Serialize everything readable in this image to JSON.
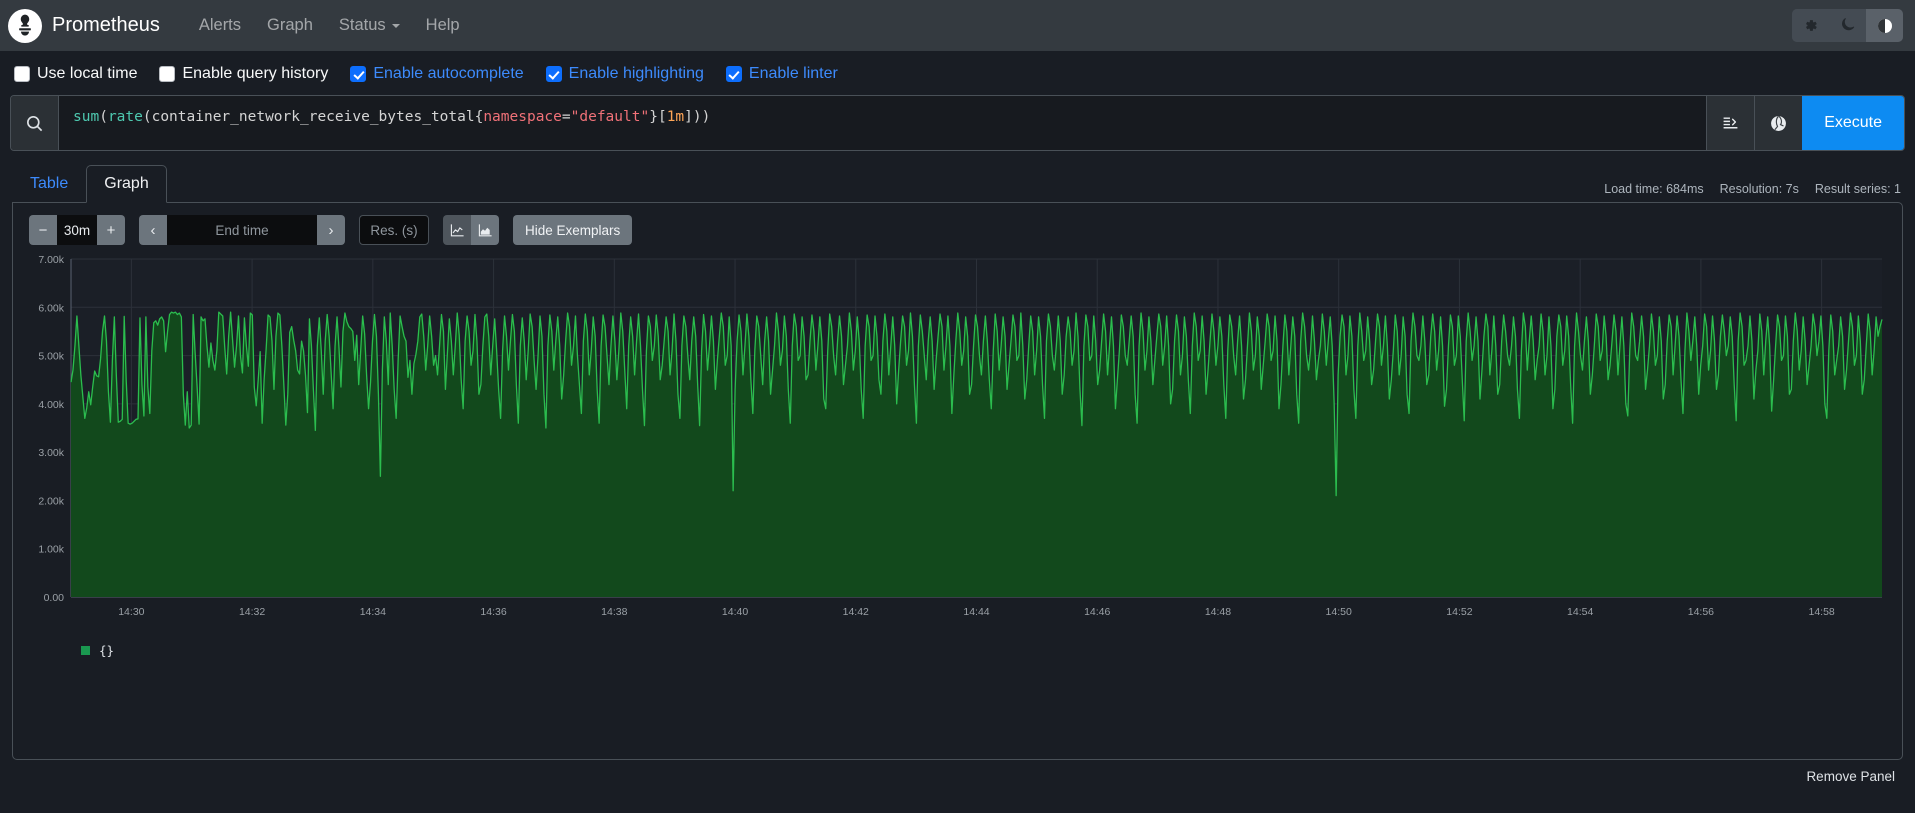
{
  "navbar": {
    "brand": "Prometheus",
    "logo_icon": "prometheus-torch-icon",
    "links": [
      {
        "label": "Alerts",
        "name": "nav-link-alerts",
        "caret": false
      },
      {
        "label": "Graph",
        "name": "nav-link-graph",
        "caret": false
      },
      {
        "label": "Status",
        "name": "nav-link-status",
        "caret": true
      },
      {
        "label": "Help",
        "name": "nav-link-help",
        "caret": false
      }
    ],
    "theme_buttons": [
      {
        "icon": "gear-icon",
        "name": "theme-settings-button",
        "active": false
      },
      {
        "icon": "moon-icon",
        "name": "theme-dark-button",
        "active": false
      },
      {
        "icon": "half-circle-icon",
        "name": "theme-auto-button",
        "active": true
      }
    ]
  },
  "options": [
    {
      "label": "Use local time",
      "checked": false,
      "name": "checkbox-use-local-time"
    },
    {
      "label": "Enable query history",
      "checked": false,
      "name": "checkbox-enable-query-history"
    },
    {
      "label": "Enable autocomplete",
      "checked": true,
      "name": "checkbox-enable-autocomplete"
    },
    {
      "label": "Enable highlighting",
      "checked": true,
      "name": "checkbox-enable-highlighting"
    },
    {
      "label": "Enable linter",
      "checked": true,
      "name": "checkbox-enable-linter"
    }
  ],
  "query": {
    "expression": "sum (rate(container_network_receive_bytes_total{namespace=\"default\"}[1m]))",
    "tokens": [
      {
        "t": "sum ",
        "k": "fn"
      },
      {
        "t": "(",
        "k": "plain"
      },
      {
        "t": "rate",
        "k": "fn"
      },
      {
        "t": "(container_network_receive_bytes_total{",
        "k": "plain"
      },
      {
        "t": "namespace",
        "k": "lbl"
      },
      {
        "t": "=",
        "k": "plain"
      },
      {
        "t": "\"default\"",
        "k": "str"
      },
      {
        "t": "}[",
        "k": "plain"
      },
      {
        "t": "1m",
        "k": "dur"
      },
      {
        "t": "]))",
        "k": "plain"
      }
    ],
    "search_icon": "search-icon",
    "format_icon": "format-expression-icon",
    "history_icon": "metrics-explorer-icon",
    "execute_label": "Execute"
  },
  "tabs": [
    {
      "label": "Table",
      "active": false,
      "name": "tab-table"
    },
    {
      "label": "Graph",
      "active": true,
      "name": "tab-graph"
    }
  ],
  "stats": {
    "load_time": "Load time: 684ms",
    "resolution": "Resolution: 7s",
    "result_series": "Result series: 1"
  },
  "controls": {
    "decrease_label": "−",
    "range_value": "30m",
    "increase_label": "+",
    "prev_label": "‹",
    "end_time_placeholder": "End time",
    "end_time_value": "",
    "next_label": "›",
    "resolution_placeholder": "Res. (s)",
    "resolution_value": "",
    "chart_types": [
      {
        "icon": "line-chart-icon",
        "name": "chart-type-line-button",
        "selected": true
      },
      {
        "icon": "stacked-area-chart-icon",
        "name": "chart-type-stacked-button",
        "selected": false
      }
    ],
    "exemplars_label": "Hide Exemplars"
  },
  "legend": [
    {
      "label": "{}",
      "color": "#1a9850"
    }
  ],
  "footer": {
    "remove_panel_label": "Remove Panel"
  },
  "colors": {
    "accent": "#0d8bf2",
    "series_stroke": "#2bbd4e",
    "series_fill": "#12491c",
    "plot_bg": "#1b1f27",
    "grid": "#2c313a",
    "navbar_bg": "#343a40",
    "page_bg": "#191d24"
  },
  "chart_data": {
    "type": "area",
    "title": "",
    "xlabel": "",
    "ylabel": "",
    "grid": true,
    "legend_position": "bottom-left",
    "series_name": "{}",
    "stroke": "#2bbd4e",
    "fill": "#12491c",
    "xtick_labels": [
      "14:30",
      "14:32",
      "14:34",
      "14:36",
      "14:38",
      "14:40",
      "14:42",
      "14:44",
      "14:46",
      "14:48",
      "14:50",
      "14:52",
      "14:54",
      "14:56",
      "14:58"
    ],
    "ytick_labels": [
      "0.00",
      "1.00k",
      "2.00k",
      "3.00k",
      "4.00k",
      "5.00k",
      "6.00k",
      "7.00k"
    ],
    "ylim": [
      0,
      7000
    ],
    "ytick_values": [
      0,
      1000,
      2000,
      3000,
      4000,
      5000,
      6000,
      7000
    ],
    "x_start_minutes": 869.2,
    "x_end_minutes": 898.5,
    "xlim_minutes": [
      869.2,
      898.5
    ],
    "values": [
      4450,
      4700,
      5200,
      5820,
      5200,
      4600,
      4150,
      3700,
      3920,
      4250,
      3980,
      4350,
      4680,
      4580,
      4560,
      4930,
      5500,
      5820,
      5300,
      4250,
      3620,
      4900,
      5800,
      4600,
      3620,
      3640,
      3680,
      5810,
      4500,
      3600,
      3580,
      3600,
      3640,
      3680,
      3690,
      5780,
      4400,
      3750,
      5800,
      4350,
      3800,
      5100,
      5680,
      5720,
      5630,
      5760,
      5800,
      5720,
      5080,
      5500,
      5850,
      5900,
      5880,
      5900,
      5850,
      5880,
      5800,
      4200,
      3560,
      4250,
      3500,
      3560,
      5850,
      5050,
      4350,
      3580,
      5800,
      5720,
      5760,
      5200,
      4760,
      5260,
      4900,
      4700,
      5100,
      5900,
      5860,
      5820,
      5180,
      4620,
      5400,
      5900,
      5320,
      4760,
      5200,
      5820,
      5000,
      4640,
      5780,
      5200,
      4780,
      5880,
      5840,
      4350,
      3960,
      4500,
      5080,
      3600,
      4500,
      5120,
      5840,
      5800,
      5300,
      4300,
      5400,
      5880,
      5840,
      5200,
      4400,
      3560,
      4200,
      5480,
      5600,
      5320,
      5100,
      4700,
      4620,
      5300,
      5100,
      4600,
      3820,
      5760,
      5200,
      4300,
      3450,
      5200,
      5780,
      5100,
      4200,
      5300,
      5850,
      5400,
      4650,
      3900,
      5200,
      5800,
      5150,
      4350,
      5500,
      5880,
      5700,
      5600,
      5560,
      5500,
      4900,
      5420,
      4400,
      5100,
      5820,
      5450,
      4600,
      3900,
      4450,
      5300,
      5850,
      5400,
      4200,
      2500,
      4700,
      5800,
      5300,
      4400,
      5880,
      5200,
      4300,
      3700,
      4900,
      5820,
      5600,
      5400,
      5300,
      4550,
      4900,
      4200,
      4830,
      5020,
      5300,
      5800,
      5860,
      5400,
      4700,
      5200,
      5820,
      5400,
      4800,
      5000,
      4600,
      5200,
      5850,
      5500,
      4300,
      5050,
      5760,
      5300,
      4600,
      5200,
      5880,
      5420,
      4500,
      3900,
      5300,
      5820,
      5500,
      4800,
      5100,
      5850,
      5300,
      4200,
      4400,
      5200,
      5800,
      5860,
      5400,
      4600,
      5200,
      5760,
      5100,
      4300,
      3700,
      5100,
      5820,
      5400,
      4700,
      5300,
      5850,
      5500,
      4400,
      3600,
      5200,
      5780,
      5300,
      4500,
      5100,
      5860,
      5600,
      4900,
      4300,
      5000,
      5820,
      5400,
      4200,
      3500,
      5200,
      5840,
      5500,
      4700,
      5300,
      5800,
      5200,
      4100,
      4600,
      5300,
      5880,
      5600,
      4800,
      5200,
      5820,
      5000,
      4400,
      3800,
      5300,
      5860,
      5500,
      4600,
      5100,
      5800,
      5400,
      4300,
      3600,
      5200,
      5840,
      5600,
      5000,
      4400,
      5200,
      5820,
      5300,
      4500,
      5100,
      5880,
      5500,
      4700,
      3900,
      5200,
      5800,
      5400,
      4600,
      5300,
      5860,
      5200,
      4300,
      3550,
      5100,
      5820,
      5600,
      4900,
      5200,
      5840,
      5400,
      4500,
      4800,
      5300,
      5800,
      5500,
      4600,
      5100,
      5860,
      5300,
      4200,
      3700,
      5200,
      5820,
      5600,
      5000,
      4500,
      5300,
      5800,
      5400,
      4400,
      3550,
      5100,
      5850,
      5500,
      4700,
      5200,
      5820,
      5300,
      4300,
      4900,
      5400,
      5880,
      5600,
      4800,
      5000,
      5800,
      5200,
      2200,
      4300,
      5300,
      5840,
      5500,
      4600,
      5200,
      5860,
      5400,
      4500,
      3800,
      5100,
      5820,
      5600,
      5000,
      4400,
      5300,
      5800,
      5300,
      4200,
      4700,
      5200,
      5880,
      5500,
      4800,
      5100,
      5820,
      5400,
      4300,
      3600,
      5200,
      5860,
      5600,
      4900,
      5000,
      5800,
      5400,
      4500,
      4600,
      5300,
      5840,
      5500,
      4700,
      5200,
      5800,
      5300,
      4100,
      3900,
      5100,
      5860,
      5600,
      5000,
      4600,
      5300,
      5820,
      5400,
      4400,
      4800,
      5200,
      5880,
      5500,
      4700,
      5100,
      5800,
      5300,
      4300,
      3700,
      5200,
      5840,
      5600,
      4900,
      5000,
      5820,
      5400,
      4500,
      4200,
      5300,
      5860,
      5500,
      4600,
      5200,
      5800,
      5200,
      4000,
      4700,
      5300,
      5820,
      5600,
      4800,
      5100,
      5880,
      5400,
      4400,
      3600,
      5200,
      5840,
      5500,
      5000,
      4500,
      5300,
      5800,
      5300,
      4300,
      4900,
      5400,
      5860,
      5600,
      4700,
      5200,
      5820,
      5200,
      3800,
      4600,
      5300,
      5880,
      5500,
      4800,
      5100,
      5800,
      5400,
      4200,
      4400,
      5200,
      5840,
      5600,
      5000,
      4600,
      5300,
      5820,
      5300,
      4500,
      3900,
      5100,
      5860,
      5500,
      4700,
      5200,
      5800,
      5400,
      4300,
      4800,
      5300,
      5840,
      5600,
      4900,
      5000,
      5880,
      5200,
      4100,
      4500,
      5200,
      5820,
      5500,
      4600,
      5100,
      5800,
      5400,
      4400,
      3700,
      5300,
      5860,
      5600,
      5000,
      4700,
      5200,
      5820,
      5300,
      4200,
      4600,
      5400,
      5800,
      5500,
      4800,
      5100,
      5880,
      5400,
      4300,
      3550,
      5200,
      5840,
      5600,
      4900,
      5000,
      5820,
      5300,
      4400,
      4700,
      5300,
      5860,
      5500,
      4600,
      5200,
      5800,
      5200,
      3900,
      4500,
      5100,
      5840,
      5600,
      5000,
      4800,
      5300,
      5820,
      5400,
      4200,
      3600,
      5200,
      5880,
      5500,
      4700,
      5100,
      5800,
      5300,
      4400,
      4900,
      5400,
      5860,
      5600,
      4800,
      5200,
      5820,
      5200,
      4000,
      4300,
      5300,
      5840,
      5500,
      4600,
      5000,
      5800,
      5400,
      4500,
      3800,
      5200,
      5880,
      5600,
      4900,
      5100,
      5820,
      5300,
      4200,
      4700,
      5300,
      5860,
      5500,
      4800,
      5200,
      5800,
      5400,
      4400,
      3700,
      5100,
      5840,
      5600,
      5000,
      4600,
      5300,
      5820,
      5200,
      4100,
      4500,
      5200,
      5880,
      5500,
      4700,
      5000,
      5800,
      5400,
      4300,
      4800,
      5300,
      5860,
      5600,
      4900,
      5100,
      5820,
      5300,
      3900,
      4400,
      5200,
      5840,
      5500,
      4600,
      5200,
      5800,
      5400,
      4200,
      3600,
      5300,
      5880,
      5600,
      5000,
      4700,
      5100,
      5820,
      5300,
      4500,
      4900,
      5200,
      5860,
      5500,
      4800,
      5300,
      5800,
      5200,
      4000,
      2100,
      4600,
      5400,
      5840,
      5600,
      4600,
      5000,
      5820,
      5400,
      4300,
      3700,
      5200,
      5880,
      5500,
      4900,
      5100,
      5800,
      5300,
      4400,
      4700,
      5300,
      5860,
      5600,
      4800,
      5200,
      5820,
      5200,
      4100,
      4500,
      5100,
      5840,
      5500,
      4600,
      5000,
      5800,
      5400,
      4200,
      3800,
      5300,
      5880,
      5600,
      5000,
      4900,
      5200,
      5820,
      5300,
      4400,
      4600,
      5400,
      5860,
      5500,
      4700,
      5100,
      5800,
      5200,
      3950,
      4300,
      5200,
      5840,
      5600,
      4800,
      5000,
      5820,
      5400,
      4500,
      3650,
      5300,
      5880,
      5500,
      4900,
      5200,
      5800,
      5300,
      4100,
      4700,
      5400,
      5860,
      5600,
      4600,
      5100,
      5820,
      5200,
      4200,
      4400,
      5300,
      5840,
      5500,
      5000,
      4800,
      5200,
      5800,
      5400,
      4300,
      3700,
      5100,
      5880,
      5600,
      4700,
      5300,
      5820,
      5300,
      4500,
      4900,
      5200,
      5860,
      5500,
      4600,
      5000,
      5800,
      5200,
      3900,
      4300,
      5400,
      5840,
      5600,
      4800,
      5100,
      5820,
      5400,
      4400,
      3600,
      5200,
      5880,
      5500,
      5000,
      4700,
      5300,
      5800,
      5300,
      4200,
      4600,
      5200,
      5860,
      5600,
      4900,
      5100,
      5820,
      5400,
      4500,
      4800,
      5300,
      5840,
      5500,
      4600,
      5200,
      5800,
      5200,
      4000,
      3750,
      5100,
      5880,
      5600,
      5000,
      4900,
      5300,
      5820,
      5400,
      4300,
      4700,
      5200,
      5860,
      5500,
      4800,
      5000,
      5800,
      5300,
      4100,
      4400,
      5300,
      5840,
      5600,
      4600,
      5200,
      5820,
      5400,
      4500,
      3800,
      5100,
      5880,
      5500,
      4900,
      5300,
      5800,
      5200,
      4200,
      4800,
      5200,
      5860,
      5600,
      4700,
      5100,
      5820,
      5300,
      4300,
      4600,
      5400,
      5840,
      5500,
      5000,
      5200,
      5800,
      5400,
      4400,
      3650,
      5300,
      5880,
      5600,
      4800,
      4900,
      5200,
      5820,
      5300,
      4100,
      4700,
      5100,
      5860,
      5500,
      4600,
      5300,
      5800,
      5200,
      3850,
      4500,
      5200,
      5840,
      5600,
      4900,
      5000,
      5820,
      5400,
      4200,
      4300,
      5300,
      5880,
      5500,
      4700,
      5100,
      5800,
      5300,
      4400,
      4800,
      5200,
      5860,
      5600,
      5000,
      5300,
      5820,
      5200,
      4000,
      3700,
      5100,
      5840,
      5500,
      4600,
      4900,
      5200,
      5800,
      5400,
      4300,
      4700,
      5300,
      5880,
      5600,
      4800,
      5000,
      5820,
      5300,
      4200,
      4500,
      5200,
      5860,
      5500,
      4600,
      5100,
      5800,
      5400,
      5600,
      5750
    ]
  }
}
